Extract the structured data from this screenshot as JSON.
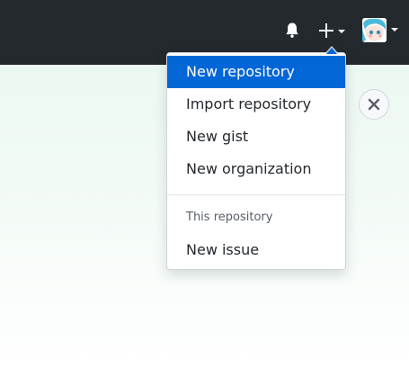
{
  "header": {
    "icons": {
      "bell": "bell-icon",
      "plus": "plus-icon",
      "caret": "caret-down-icon",
      "avatar": "avatar"
    }
  },
  "dropdown": {
    "items": [
      {
        "label": "New repository",
        "active": true
      },
      {
        "label": "Import repository",
        "active": false
      },
      {
        "label": "New gist",
        "active": false
      },
      {
        "label": "New organization",
        "active": false
      }
    ],
    "section_header": "This repository",
    "section_items": [
      {
        "label": "New issue",
        "active": false
      }
    ]
  },
  "main": {
    "close_icon": "close-icon"
  },
  "colors": {
    "header_bg": "#24292e",
    "accent": "#0366d6",
    "page_bg": "#e9f7f0",
    "text": "#24292e",
    "muted_text": "#586069"
  }
}
